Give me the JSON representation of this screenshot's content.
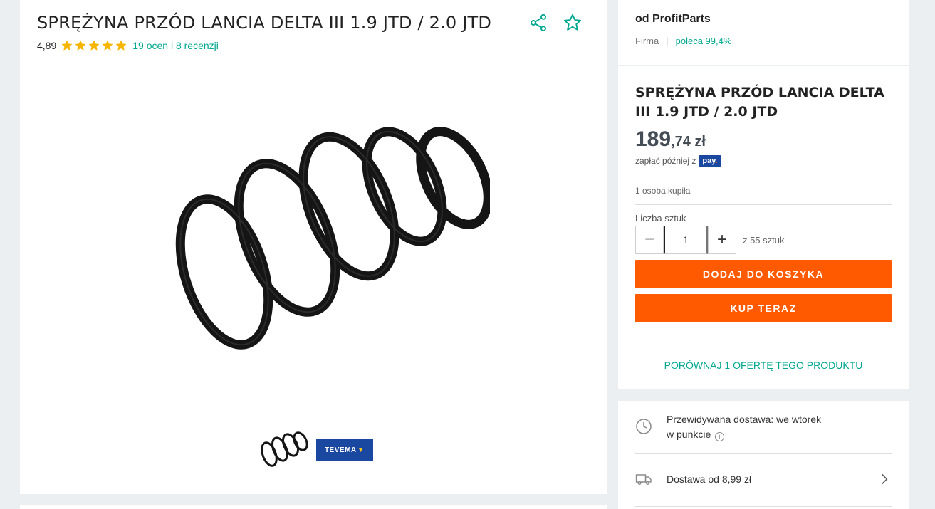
{
  "product": {
    "title": "SPRĘŻYNA PRZÓD LANCIA DELTA III 1.9 JTD / 2.0 JTD",
    "rating_value": "4,89",
    "rating_stars": 5,
    "reviews_link": "19 ocen i 8 recenzji",
    "thumb_brand": "TEVEMA"
  },
  "icons": {
    "share": "share-icon",
    "favorite": "star-outline-icon",
    "rating_star": "star-filled-icon",
    "clock": "clock-icon",
    "truck": "truck-icon",
    "chevron": "chevron-right-icon",
    "info": "info-icon"
  },
  "seller": {
    "name": "od ProfitParts",
    "type": "Firma",
    "recommend": "poleca 99,4%"
  },
  "buy": {
    "title": "SPRĘŻYNA PRZÓD LANCIA DELTA III 1.9 JTD / 2.0 JTD",
    "price_main": "189",
    "price_frac": ",74 zł",
    "pay_later": "zapłać później z",
    "pay_badge": "pay",
    "bought": "1 osoba kupiła",
    "qty_label": "Liczba sztuk",
    "qty_value": "1",
    "qty_minus": "−",
    "qty_plus": "+",
    "qty_of": "z 55 sztuk",
    "add_to_cart": "DODAJ DO KOSZYKA",
    "buy_now": "KUP TERAZ"
  },
  "compare": {
    "label": "PORÓWNAJ 1 OFERTĘ TEGO PRODUKTU"
  },
  "delivery": {
    "expected_line1": "Przewidywana dostawa: we wtorek",
    "expected_line2": "w punkcie",
    "info_glyph": "i",
    "cost": "Dostawa od 8,99 zł"
  },
  "colors": {
    "accent_green": "#00a790",
    "button_orange": "#ff5a00",
    "star_yellow": "#f7b500",
    "pay_blue": "#1a47a0"
  }
}
